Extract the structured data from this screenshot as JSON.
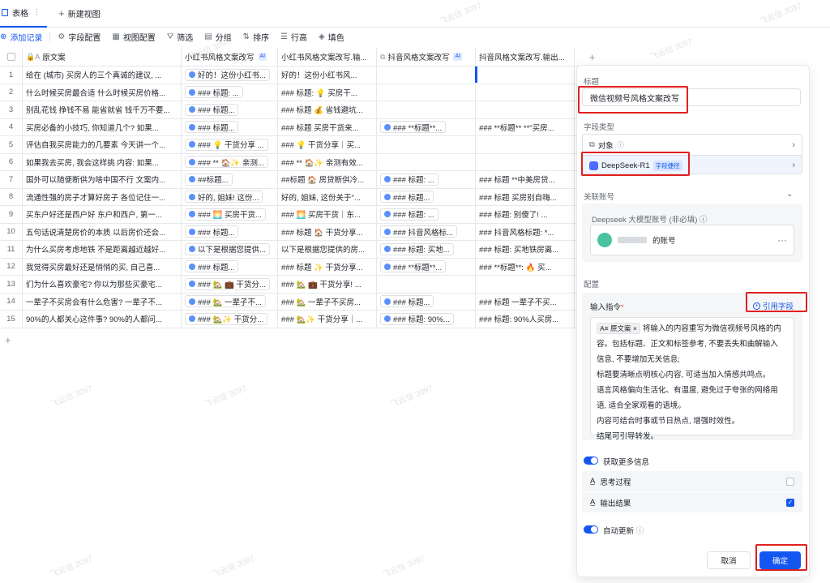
{
  "tabs": {
    "table_tab": "表格",
    "new_view": "新建视图"
  },
  "toolbar": {
    "add_record": "添加记录",
    "field_config": "字段配置",
    "view_config": "视图配置",
    "filter": "筛选",
    "group": "分组",
    "sort": "排序",
    "row_height": "行高",
    "fill_color": "填色"
  },
  "columns": {
    "c1": "原文案",
    "c2": "小红书风格文案改写",
    "c3": "小红书风格文案改写.输...",
    "c4": "抖音风格文案改写",
    "c5": "抖音风格文案改写.输出..."
  },
  "ai_tag": "AI",
  "rows": [
    {
      "n": "1",
      "c1": "给在 (城市) 买房人的三个真诚的建议, ...",
      "c2": "好的！这份小红书...",
      "c3": "好的！这份小红书风...",
      "c4": "",
      "c5": ""
    },
    {
      "n": "2",
      "c1": "什么时候买房最合适 什么时候买房价格...",
      "c2": "### 标题: ...",
      "c3": "### 标题: 💡 买房干...",
      "c4": "",
      "c5": ""
    },
    {
      "n": "3",
      "c1": "别乱花钱 挣钱不易 能省就省 钱千万不要...",
      "c2": "### 标题...",
      "c3": "### 标题 💰 省钱避坑...",
      "c4": "",
      "c5": ""
    },
    {
      "n": "4",
      "c1": "买房必备的小技巧, 你知道几个? 如果...",
      "c2": "### 标题...",
      "c3": "### 标题 买房干货来...",
      "c4": "### **标题**...",
      "c5": "### **标题** **\"买房..."
    },
    {
      "n": "5",
      "c1": "评估自我买房能力的几要素 今天讲一个...",
      "c2": "### 💡 干货分享 ...",
      "c3": "### 💡 干货分享｜买...",
      "c4": "",
      "c5": ""
    },
    {
      "n": "6",
      "c1": "如果我去买房, 我会这样挑 内容: 如果...",
      "c2": "### ** 🏠✨ 亲测...",
      "c3": "### ** 🏠✨ 亲测有效...",
      "c4": "",
      "c5": ""
    },
    {
      "n": "7",
      "c1": "国外可以随便断供为啥中国不行 文案内...",
      "c2": "##标题...",
      "c3": "##标题 🏠 房贷断供冷...",
      "c4": "### 标题: ...",
      "c5": "### 标题 **中美房贷..."
    },
    {
      "n": "8",
      "c1": "流通性强的房子才算好房子 各位记住一...",
      "c2": "好的, 姐妹! 这份...",
      "c3": "好的, 姐妹, 这份关于\"...",
      "c4": "### 标题...",
      "c5": "### 标题 买房别自嗨..."
    },
    {
      "n": "9",
      "c1": "买东户好还是西户好 东户和西户, 第一...",
      "c2": "### 🌅 买房干货...",
      "c3": "### 🌅 买房干货｜东...",
      "c4": "### 标题: ...",
      "c5": "### 标题: 别傻了! ..."
    },
    {
      "n": "10",
      "c1": "五句话说清楚房价的本质 以后房价还会...",
      "c2": "### 标题...",
      "c3": "### 标题 🏠 干货分享...",
      "c4": "### 抖音风格标...",
      "c5": "### 抖音风格标题: *..."
    },
    {
      "n": "11",
      "c1": "为什么买房考虑地铁 不是距离越近越好...",
      "c2": "以下是根据您提供...",
      "c3": "以下是根据您提供的房...",
      "c4": "### 标题: 买地...",
      "c5": "### 标题: 买地铁房离..."
    },
    {
      "n": "12",
      "c1": "我觉得买房最好还是悄悄的买, 自己喜...",
      "c2": "### 标题...",
      "c3": "### 标题 ✨ 干货分享...",
      "c4": "### **标题**...",
      "c5": "### **标题**: 🔥 买..."
    },
    {
      "n": "13",
      "c1": "们为什么喜欢豪宅? 你以为那些买豪宅...",
      "c2": "### 🏡 💼 干货分...",
      "c3": "### 🏡 💼 干货分享! ...",
      "c4": "",
      "c5": ""
    },
    {
      "n": "14",
      "c1": "一辈子不买房会有什么危害? 一辈子不...",
      "c2": "### 🏡 一辈子不...",
      "c3": "### 🏡 一辈子不买房...",
      "c4": "### 标题...",
      "c5": "### 标题 一辈子不买..."
    },
    {
      "n": "15",
      "c1": "90%的人都关心这件事? 90%的人都问...",
      "c2": "### 🏡✨ 干货分...",
      "c3": "### 🏡✨ 干货分享｜...",
      "c4": "### 标题: 90%...",
      "c5": "### 标题: 90%人买房..."
    }
  ],
  "panel": {
    "title_label": "标题",
    "title_value": "微信视频号风格文案改写",
    "field_type_label": "字段类型",
    "field_type_object": "对象",
    "field_type_selected": "DeepSeek-R1",
    "field_type_tag": "字段捷径",
    "account_label": "关联账号",
    "account_desc": "Deepseek 大模型账号 (非必填)",
    "account_name": "的账号",
    "config_label": "配置",
    "prompt_label": "输入指令",
    "cite_field": "引用字段",
    "prompt_tag": "原文案",
    "prompt_lines": [
      "将输入的内容重写为微信视频号风格的内",
      "容。包括标题、正文和标签参考, 不要丢失和曲解输入",
      "信息, 不要增加无关信息;",
      "标题要清晰点明核心内容, 可适当加入情感共鸣点。",
      "语言风格偏向生活化、有温度, 避免过于夸张的网络用",
      "语, 适合全家观看的语境。",
      "内容可结合时事或节日热点, 增强时效性。",
      "结尾可引导转发。"
    ],
    "more_info_label": "获取更多信息",
    "thinking_label": "思考过程",
    "output_label": "输出结果",
    "auto_update_label": "自动更新",
    "cancel": "取消",
    "confirm": "确定"
  },
  "watermark": "飞云信 3097"
}
